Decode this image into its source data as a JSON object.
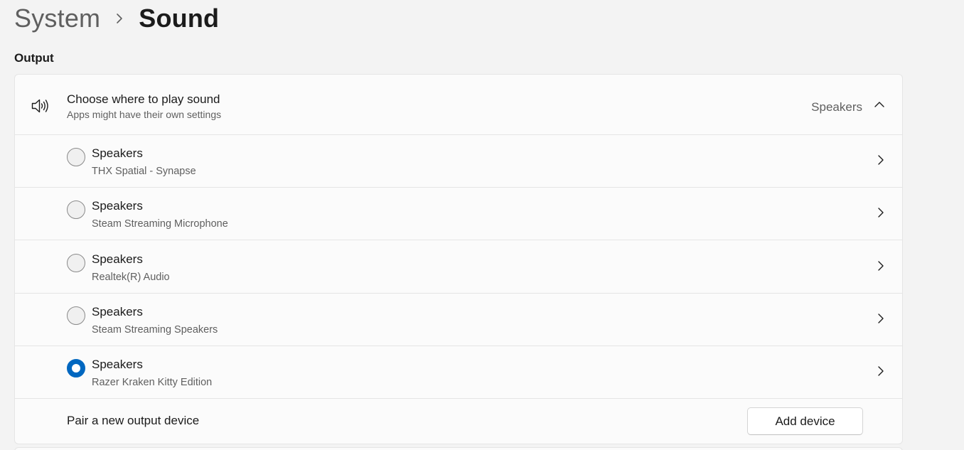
{
  "breadcrumb": {
    "parent": "System",
    "separator_icon": "chevron-right-icon",
    "current": "Sound"
  },
  "output_section": {
    "title": "Output",
    "header": {
      "icon": "speaker-icon",
      "title": "Choose where to play sound",
      "subtitle": "Apps might have their own settings",
      "selected_value": "Speakers",
      "expand_icon": "chevron-up-icon",
      "expanded": true
    },
    "devices": [
      {
        "name": "Speakers",
        "description": "THX Spatial - Synapse",
        "selected": false
      },
      {
        "name": "Speakers",
        "description": "Steam Streaming Microphone",
        "selected": false
      },
      {
        "name": "Speakers",
        "description": "Realtek(R) Audio",
        "selected": false
      },
      {
        "name": "Speakers",
        "description": "Steam Streaming Speakers",
        "selected": false
      },
      {
        "name": "Speakers",
        "description": "Razer Kraken Kitty Edition",
        "selected": true
      }
    ],
    "pair": {
      "label": "Pair a new output device",
      "button_label": "Add device"
    }
  },
  "colors": {
    "accent": "#0067c0",
    "background": "#f3f3f3",
    "card": "#fbfbfb",
    "secondary_text": "#5f5f5f"
  }
}
